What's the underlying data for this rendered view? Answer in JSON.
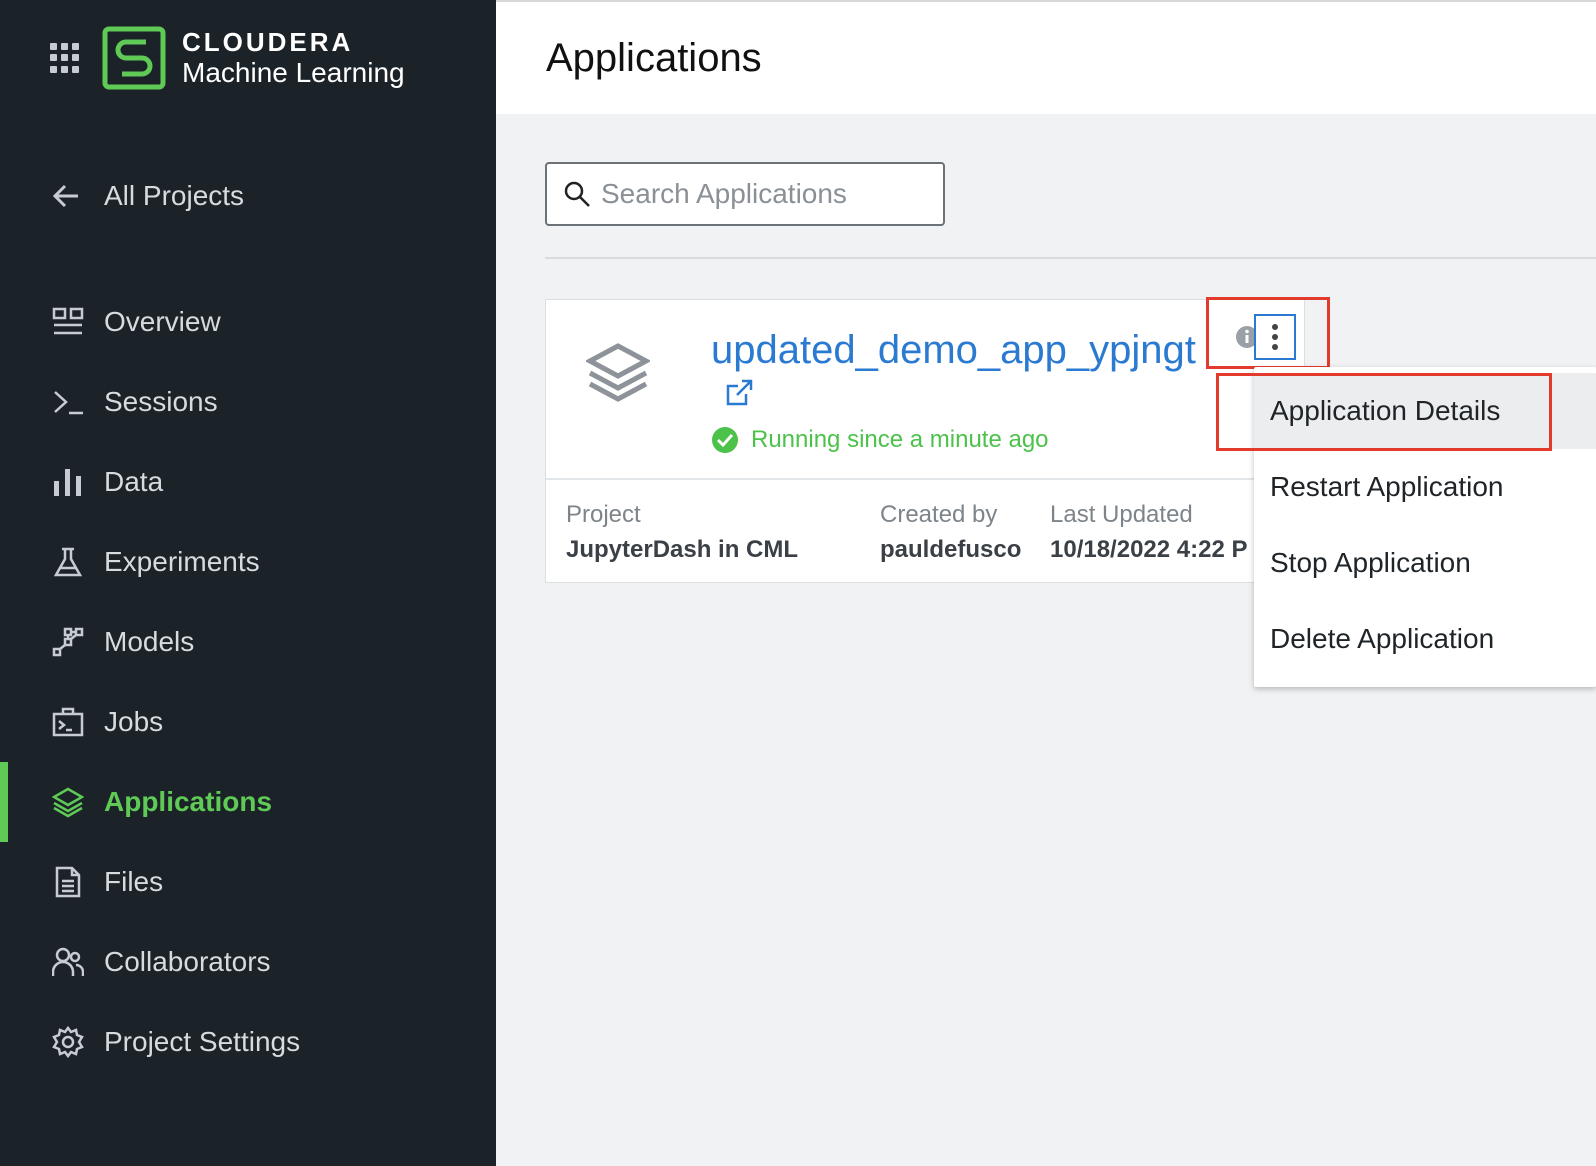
{
  "brand": {
    "name": "CLOUDERA",
    "sub": "Machine Learning",
    "accent": "#5fca55"
  },
  "sidebar": {
    "back_label": "All Projects",
    "items": [
      {
        "label": "Overview",
        "icon": "overview-icon"
      },
      {
        "label": "Sessions",
        "icon": "terminal-icon"
      },
      {
        "label": "Data",
        "icon": "bar-chart-icon"
      },
      {
        "label": "Experiments",
        "icon": "flask-icon"
      },
      {
        "label": "Models",
        "icon": "network-icon"
      },
      {
        "label": "Jobs",
        "icon": "jobs-icon"
      },
      {
        "label": "Applications",
        "icon": "layers-icon",
        "active": true
      },
      {
        "label": "Files",
        "icon": "file-icon"
      },
      {
        "label": "Collaborators",
        "icon": "users-icon"
      },
      {
        "label": "Project Settings",
        "icon": "gear-icon"
      }
    ]
  },
  "page": {
    "title": "Applications",
    "search_placeholder": "Search Applications"
  },
  "app_card": {
    "name": "updated_demo_app_ypjngt",
    "status": "Running since a minute ago",
    "status_color": "#4cc24a",
    "project_label": "Project",
    "project_value": "JupyterDash in CML",
    "created_label": "Created by",
    "created_value": "pauldefusco",
    "updated_label": "Last Updated",
    "updated_value": "10/18/2022 4:22 P"
  },
  "menu": {
    "items": [
      "Application Details",
      "Restart Application",
      "Stop Application",
      "Delete Application"
    ]
  },
  "annotation_color": "#e23b2e"
}
